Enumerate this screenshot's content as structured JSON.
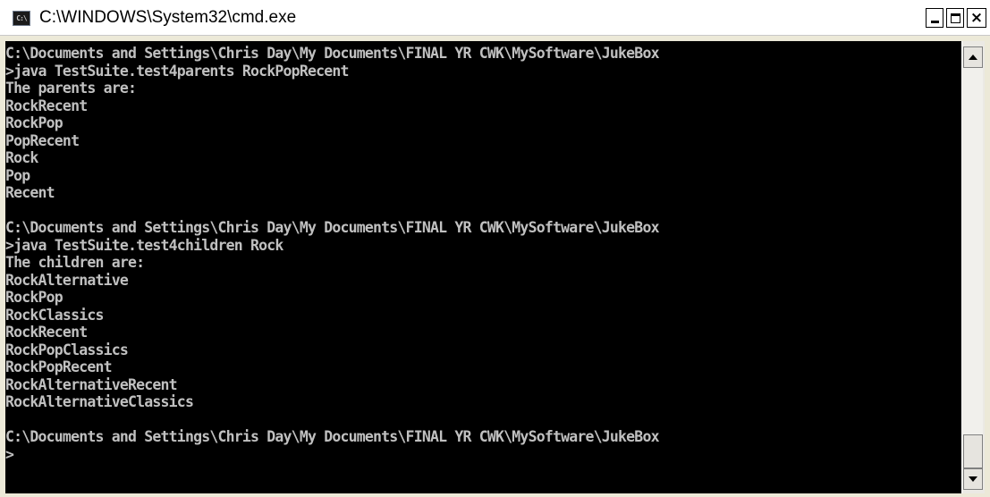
{
  "window": {
    "title": "C:\\WINDOWS\\System32\\cmd.exe",
    "icon_label": "C:\\"
  },
  "console": {
    "lines": [
      "C:\\Documents and Settings\\Chris Day\\My Documents\\FINAL YR CWK\\MySoftware\\JukeBox",
      ">java TestSuite.test4parents RockPopRecent",
      "The parents are:",
      "RockRecent",
      "RockPop",
      "PopRecent",
      "Rock",
      "Pop",
      "Recent",
      "",
      "C:\\Documents and Settings\\Chris Day\\My Documents\\FINAL YR CWK\\MySoftware\\JukeBox",
      ">java TestSuite.test4children Rock",
      "The children are:",
      "RockAlternative",
      "RockPop",
      "RockClassics",
      "RockRecent",
      "RockPopClassics",
      "RockPopRecent",
      "RockAlternativeRecent",
      "RockAlternativeClassics",
      "",
      "C:\\Documents and Settings\\Chris Day\\My Documents\\FINAL YR CWK\\MySoftware\\JukeBox",
      ">"
    ],
    "text_color": "#c0c0c0",
    "background": "#000000"
  },
  "scrollbar": {
    "position": 1.0
  }
}
